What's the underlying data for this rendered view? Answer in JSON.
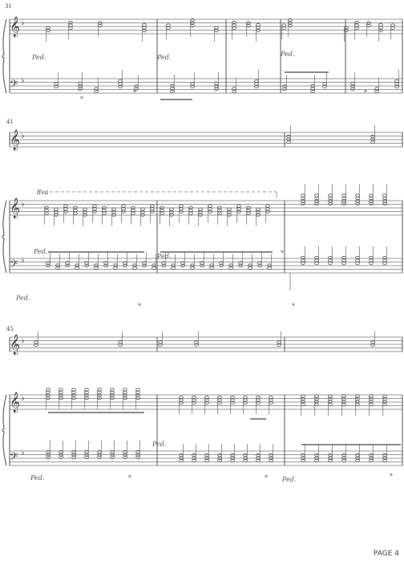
{
  "page": {
    "number_label": "PAGE 4"
  },
  "systems": [
    {
      "measure_number": "31",
      "dynamics_treble": "",
      "dynamics_bass": [
        "Ped.",
        "*",
        "Ped.",
        "*",
        "Ped.",
        "*"
      ]
    },
    {
      "measure_number": "41",
      "ottava": "8va",
      "dynamics_bass": [
        "Ped.",
        "*",
        "Ped.",
        "*"
      ],
      "dynamics_bottom": [
        "Ped.",
        "*"
      ]
    },
    {
      "measure_number": "45",
      "dynamics_bass": [
        "Ped.",
        "*",
        "Ped.",
        "*",
        "Ped.",
        "*"
      ]
    }
  ],
  "colors": {
    "ink": "#555555",
    "staff": "#777777"
  }
}
